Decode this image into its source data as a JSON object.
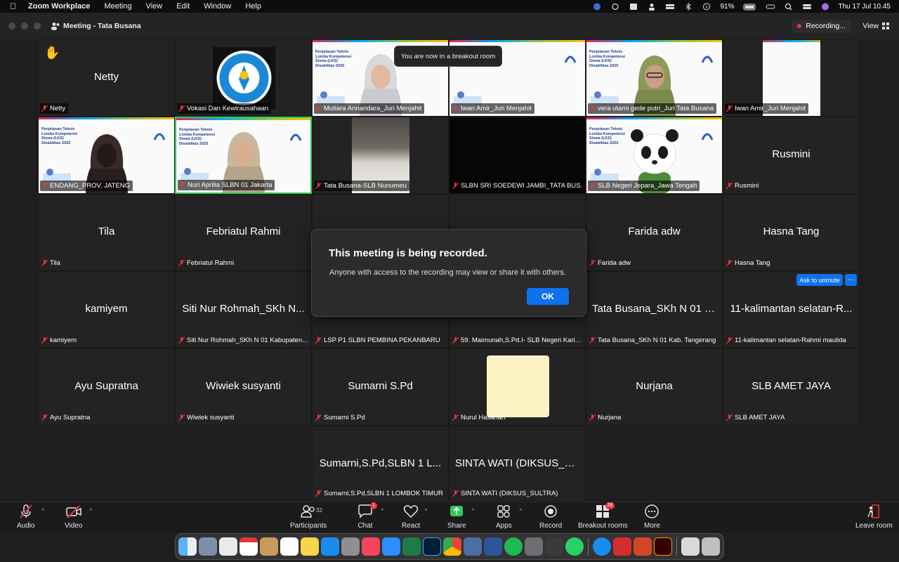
{
  "menubar": {
    "app": "Zoom Workplace",
    "items": [
      "Meeting",
      "View",
      "Edit",
      "Window",
      "Help"
    ],
    "battery": "91%",
    "datetime": "Thu 17 Jul  10.45"
  },
  "window": {
    "title": "Meeting - Tata Busana",
    "recording_label": "Recording...",
    "view_label": "View"
  },
  "tiles": [
    {
      "big": "Netty",
      "label": "Netty"
    },
    {
      "big": "",
      "label": "Vokasi Dan Kewirausahaan"
    },
    {
      "big": "",
      "label": "Mutiara Annandara_Juri Menjahit"
    },
    {
      "big": "",
      "label": "Iwan Amir_Juri Menjahit"
    },
    {
      "big": "",
      "label": "vera utami gede putri_Juri Tata Busana"
    },
    {
      "big": "",
      "label": "Iwan Amir_Juri Menjahit"
    },
    {
      "big": "",
      "label": "ENDANG_PROV. JATENG"
    },
    {
      "big": "",
      "label": "Nuri Aprilia SLBN 01 Jakarta"
    },
    {
      "big": "",
      "label": "Tata Busana-SLB Nunumeu"
    },
    {
      "big": "",
      "label": "SLBN SRI SOEDEWI JAMBI_TATA BUS..."
    },
    {
      "big": "",
      "label": "SLB Negeri Jepara_Jawa Tengah"
    },
    {
      "big": "Rusmini",
      "label": "Rusmini"
    },
    {
      "big": "Tila",
      "label": "Tila"
    },
    {
      "big": "Febriatul Rahmi",
      "label": "Febriatul Rahmi"
    },
    {
      "big": "",
      "label": ""
    },
    {
      "big": "",
      "label": ""
    },
    {
      "big": "Farida adw",
      "label": "Farida adw"
    },
    {
      "big": "Hasna Tang",
      "label": "Hasna Tang"
    },
    {
      "big": "kamiyem",
      "label": "kamiyem"
    },
    {
      "big": "Siti Nur Rohmah_SKh N...",
      "label": "Siti Nur Rohmah_SKh N 01 Kabupaten..."
    },
    {
      "big": "",
      "label": "LSP P1 SLBN PEMBINA PEKANBARU"
    },
    {
      "big": "",
      "label": "59. Maimunah,S.Pd.I- SLB Negeri Kari..."
    },
    {
      "big": "Tata Busana_SKh N 01 K...",
      "label": "Tata Busana_SKh N 01 Kab. Tangerang"
    },
    {
      "big": "11-kalimantan selatan-R...",
      "label": "11-kalimantan selatan-Rahmi maulida"
    },
    {
      "big": "Ayu Supratna",
      "label": "Ayu Supratna"
    },
    {
      "big": "Wiwiek susyanti",
      "label": "Wiwiek susyanti"
    },
    {
      "big": "Sumarni S.Pd",
      "label": "Sumarni S.Pd"
    },
    {
      "big": "",
      "label": "Nurul Hasanah"
    },
    {
      "big": "Nurjana",
      "label": "Nurjana"
    },
    {
      "big": "SLB AMET JAYA",
      "label": "SLB AMET JAYA"
    },
    {
      "big": "Sumarni,S.Pd,SLBN 1 L...",
      "label": "Sumarni,S.Pd,SLBN 1 LOMBOK TIMUR"
    },
    {
      "big": "SINTA WATI (DIKSUS_S...",
      "label": "SINTA WATI (DIKSUS_SULTRA)"
    }
  ],
  "slide_text": "Penjelasan Teknis Lomba Kompetensi Siswa (LKS) Disabilitas 2025",
  "toast": "You are now in a breakout room",
  "dialog": {
    "title": "This meeting is being recorded.",
    "body": "Anyone with access to the recording may view or share it with others.",
    "ok": "OK"
  },
  "unmute": {
    "label": "Ask to unmute",
    "more": "···"
  },
  "toolbar": {
    "audio": "Audio",
    "video": "Video",
    "participants": "Participants",
    "participants_count": "32",
    "chat": "Chat",
    "chat_badge": "1",
    "react": "React",
    "share": "Share",
    "apps": "Apps",
    "record": "Record",
    "breakout": "Breakout rooms",
    "breakout_badge": "28",
    "more": "More",
    "leave": "Leave room"
  },
  "colors": {
    "zoom_blue": "#0e72ed",
    "share_green": "#2ecc55",
    "mute_red": "#e8343d"
  }
}
